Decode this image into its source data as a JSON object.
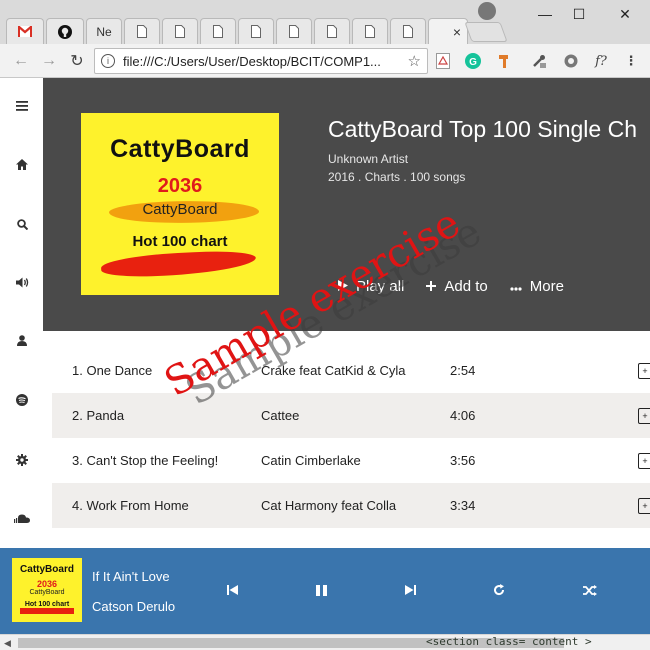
{
  "browser": {
    "tabs": [
      {
        "label": "",
        "icon": "gmail-icon"
      },
      {
        "label": "",
        "icon": "github-icon"
      },
      {
        "label": "Ne",
        "icon": "doc-icon"
      },
      {
        "label": "",
        "icon": "doc-icon"
      },
      {
        "label": "",
        "icon": "doc-icon"
      },
      {
        "label": "",
        "icon": "doc-icon"
      },
      {
        "label": "",
        "icon": "doc-icon"
      },
      {
        "label": "",
        "icon": "doc-icon"
      },
      {
        "label": "",
        "icon": "doc-icon"
      },
      {
        "label": "",
        "icon": "doc-icon"
      },
      {
        "label": "",
        "icon": "doc-icon",
        "active": true
      }
    ],
    "tab_close": "×",
    "window_controls": {
      "minimize": "—",
      "maximize": "☐",
      "close": "✕"
    },
    "address": "file:///C:/Users/User/Desktop/BCIT/COMP1...",
    "extensions": [
      "pdf-icon",
      "grammarly-icon",
      "hammer-icon",
      "eyedropper-icon",
      "settings-icon",
      "formula-icon",
      "menu-icon"
    ],
    "formula_label": "f?"
  },
  "sidebar": {
    "items": [
      "menu-icon",
      "home-icon",
      "search-icon",
      "volume-icon",
      "user-icon",
      "spotify-icon",
      "gear-icon",
      "soundcloud-icon"
    ]
  },
  "album": {
    "cover": {
      "brand": "CattyBoard",
      "year": "2036",
      "sub": "CattyBoard",
      "chart": "Hot 100 chart"
    },
    "title": "CattyBoard Top 100 Single Ch",
    "artist": "Unknown Artist",
    "meta": "2016 . Charts . 100 songs",
    "actions": {
      "play_all": "Play all",
      "add_to": "Add to",
      "more": "More"
    }
  },
  "tracks": [
    {
      "name": "1. One Dance",
      "artist": "Crake feat CatKid & Cyla",
      "time": "2:54"
    },
    {
      "name": "2. Panda",
      "artist": "Cattee",
      "time": "4:06"
    },
    {
      "name": "3. Can't Stop the Feeling!",
      "artist": "Catin Cimberlake",
      "time": "3:56"
    },
    {
      "name": "4. Work From Home",
      "artist": "Cat Harmony feat Colla",
      "time": "3:34"
    }
  ],
  "watermark": "Sample exercise",
  "player": {
    "thumb": {
      "brand": "CattyBoard",
      "year": "2036",
      "sub": "CattyBoard",
      "chart": "Hot 100 chart"
    },
    "title": "If It Ain't Love",
    "artist": "Catson Derulo"
  },
  "scroll_peek": "<section class= content >",
  "colors": {
    "hero_bg": "#4a4a4a",
    "player_bg": "#3a75ad",
    "cover_yellow": "#fef22c",
    "row_alt": "#f0eeec",
    "watermark_red": "#e01414"
  }
}
